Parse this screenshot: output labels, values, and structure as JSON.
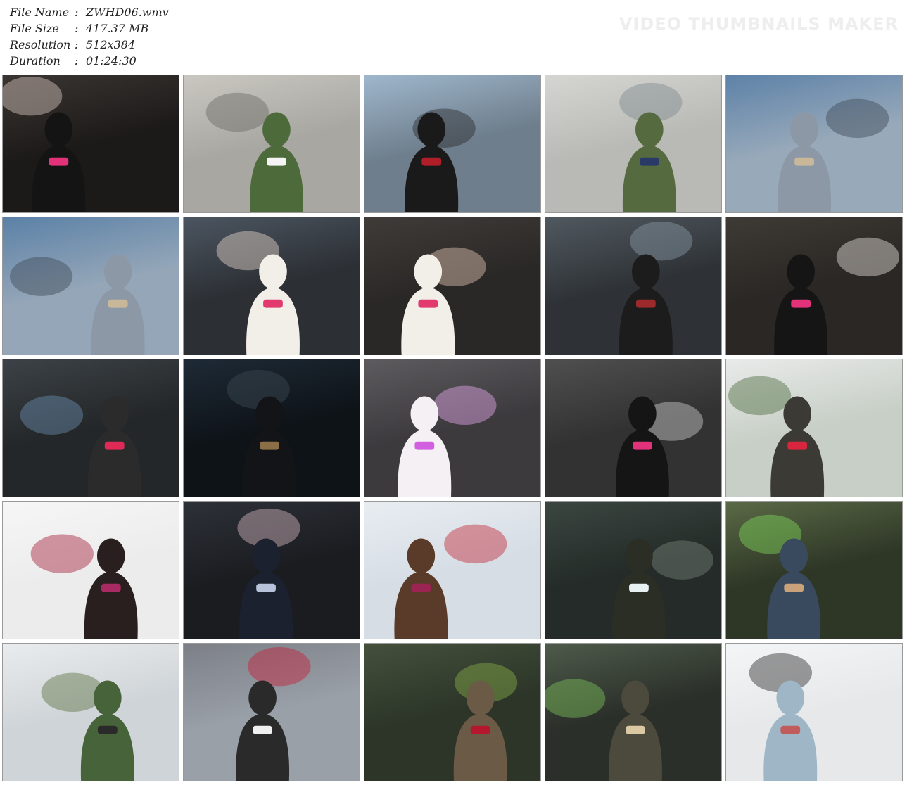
{
  "file_info": {
    "file_name_label": "File Name",
    "file_name_sep": ":",
    "file_name": "ZWHD06.wmv",
    "file_size_label": "File Size",
    "file_size_sep": ":",
    "file_size": "417.37 MB",
    "resolution_label": "Resolution",
    "resolution_sep": ":",
    "resolution": "512x384",
    "duration_label": "Duration",
    "duration_sep": ":",
    "duration": "01:24:30"
  },
  "watermark": "VIDEO THUMBNAILS MAKER",
  "thumbnails": [
    {
      "scene": "masked-villain-and-heroine-warehouse",
      "colors": [
        "#3a3532",
        "#1c1a19",
        "#d9c7c0"
      ],
      "figure": "#141414",
      "accent": "#e2327a"
    },
    {
      "scene": "heroine-running-camo-villain-street",
      "colors": [
        "#c9c7c0",
        "#a8a7a2",
        "#6b6b66"
      ],
      "figure": "#4d6a3a",
      "accent": "#f4f4f4"
    },
    {
      "scene": "hooded-villain-sky",
      "colors": [
        "#9fb7cc",
        "#6e7e8c",
        "#2b2a2c"
      ],
      "figure": "#1a1a1a",
      "accent": "#b01e2a"
    },
    {
      "scene": "camo-villain-climbing-wall",
      "colors": [
        "#d5d5d2",
        "#b9b9b5",
        "#7f8a8e"
      ],
      "figure": "#566a3f",
      "accent": "#2a3a66"
    },
    {
      "scene": "armored-villain-low-angle",
      "colors": [
        "#5d82a8",
        "#98a9ba",
        "#3e4a56"
      ],
      "figure": "#8d98a6",
      "accent": "#c9b79a"
    },
    {
      "scene": "armored-villain-low-angle-2",
      "colors": [
        "#5b81a7",
        "#94a6b8",
        "#3e4a56"
      ],
      "figure": "#8d98a6",
      "accent": "#c9b79a"
    },
    {
      "scene": "heroine-bound-closeup",
      "colors": [
        "#4b5560",
        "#2c2f34",
        "#e7d6cc"
      ],
      "figure": "#f2eee8",
      "accent": "#e23a6e"
    },
    {
      "scene": "heroine-bound-closeup-2",
      "colors": [
        "#3f3b38",
        "#2a2826",
        "#e2c5b4"
      ],
      "figure": "#f2eee8",
      "accent": "#e23a6e"
    },
    {
      "scene": "dark-armored-villain-lab",
      "colors": [
        "#50585f",
        "#2e3236",
        "#8a9aa6"
      ],
      "figure": "#1c1c1c",
      "accent": "#9c2a2a"
    },
    {
      "scene": "dark-villain-over-heroine",
      "colors": [
        "#3e3a35",
        "#2a2724",
        "#e7e1dc"
      ],
      "figure": "#151515",
      "accent": "#e2327a"
    },
    {
      "scene": "heroine-captive-lab-dark",
      "colors": [
        "#3c4247",
        "#242729",
        "#6a8fb0"
      ],
      "figure": "#2b2b2b",
      "accent": "#e02a56"
    },
    {
      "scene": "insect-villain-dark",
      "colors": [
        "#1e2a36",
        "#0e1318",
        "#3c4a52"
      ],
      "figure": "#121417",
      "accent": "#8a6e46"
    },
    {
      "scene": "heroine-with-wand-purple-light",
      "colors": [
        "#5d5b5e",
        "#3c3a3d",
        "#e6a8ee"
      ],
      "figure": "#f4f0f4",
      "accent": "#d25fe0"
    },
    {
      "scene": "heroine-defeated-street",
      "colors": [
        "#4f4f4f",
        "#323232",
        "#cfcfcf"
      ],
      "figure": "#151515",
      "accent": "#e2327a"
    },
    {
      "scene": "red-heroine-vs-camo-villain",
      "colors": [
        "#e9eaea",
        "#c7cfc6",
        "#4b6b3c"
      ],
      "figure": "#3c3a34",
      "accent": "#d8263e"
    },
    {
      "scene": "masked-red-heroine-white",
      "colors": [
        "#f6f6f6",
        "#ececec",
        "#a11e3a"
      ],
      "figure": "#2a1f1f",
      "accent": "#a82a62"
    },
    {
      "scene": "uniformed-woman-cap",
      "colors": [
        "#2d3138",
        "#1a1c20",
        "#d7b7c2"
      ],
      "figure": "#1c2130",
      "accent": "#b8c2da"
    },
    {
      "scene": "masked-red-heroine-sky",
      "colors": [
        "#e8edf2",
        "#d6dde4",
        "#c02838"
      ],
      "figure": "#5a3b2a",
      "accent": "#9b2452"
    },
    {
      "scene": "soldiers-at-night",
      "colors": [
        "#3b4641",
        "#242b28",
        "#7a837a"
      ],
      "figure": "#2a2e25",
      "accent": "#e8f0f4"
    },
    {
      "scene": "man-green-light",
      "colors": [
        "#5a6a46",
        "#2e3626",
        "#7ed85a"
      ],
      "figure": "#3a4a5e",
      "accent": "#c9a27c"
    },
    {
      "scene": "camo-masked-villain",
      "colors": [
        "#e9ecee",
        "#cfd4d8",
        "#5c7040"
      ],
      "figure": "#47633a",
      "accent": "#2a2a2a"
    },
    {
      "scene": "red-heroine-lying-tiles",
      "colors": [
        "#7c7f86",
        "#9aa0a8",
        "#c6203a"
      ],
      "figure": "#2a2a2a",
      "accent": "#f0f0f0"
    },
    {
      "scene": "camo-villain-green-light",
      "colors": [
        "#44503c",
        "#2c3528",
        "#87ad4a"
      ],
      "figure": "#6b5a45",
      "accent": "#b3182e"
    },
    {
      "scene": "gas-mask-soldier-bat",
      "colors": [
        "#4e5a4a",
        "#2a2f29",
        "#7cc05a"
      ],
      "figure": "#4c4a3c",
      "accent": "#d9c8a2"
    },
    {
      "scene": "man-looking-up-sky",
      "colors": [
        "#f4f5f6",
        "#e6e8ea",
        "#2a2a2a"
      ],
      "figure": "#9fb6c6",
      "accent": "#c05c5c"
    }
  ]
}
